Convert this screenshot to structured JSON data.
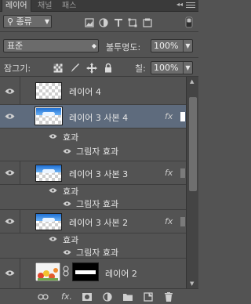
{
  "tabs": [
    {
      "label": "레이어",
      "active": true
    },
    {
      "label": "채널",
      "active": false
    },
    {
      "label": "패스",
      "active": false
    }
  ],
  "filter": {
    "label": "종류"
  },
  "blend": {
    "mode": "표준",
    "opacity_label": "불투명도:",
    "opacity_value": "100%"
  },
  "lock": {
    "label": "잠그기:",
    "fill_label": "칠:",
    "fill_value": "100%"
  },
  "layers": [
    {
      "name": "레이어 4",
      "selected": false
    },
    {
      "name": "레이어 3 사본 4",
      "selected": true,
      "fx": "fx",
      "effects_label": "효과",
      "effect": "그림자 효과"
    },
    {
      "name": "레이어 3 사본 3",
      "selected": false,
      "fx": "fx",
      "effects_label": "효과",
      "effect": "그림자 효과"
    },
    {
      "name": "레이어 3 사본 2",
      "selected": false,
      "fx": "fx",
      "effects_label": "효과",
      "effect": "그림자 효과"
    },
    {
      "name": "레이어 2",
      "selected": false
    }
  ],
  "bottom_icons": [
    "link-icon",
    "fx-icon",
    "mask-icon",
    "adjustment-icon",
    "group-icon",
    "new-layer-icon",
    "trash-icon"
  ],
  "bottom_fx": "fx.",
  "colors": {
    "panel": "#535353",
    "selected": "#5e6b7d",
    "accent": "#1f6fd2"
  }
}
